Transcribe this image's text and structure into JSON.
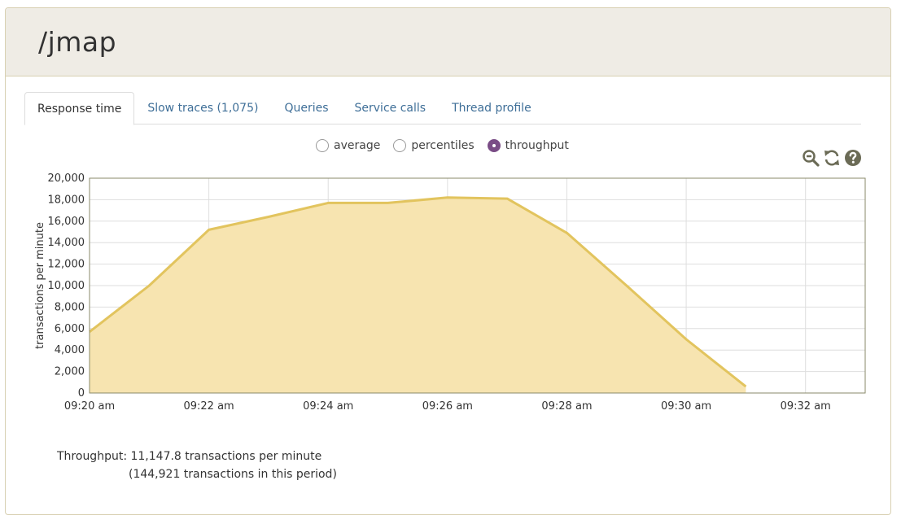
{
  "page": {
    "title": "/jmap"
  },
  "tabs": [
    {
      "label": "Response time",
      "active": true
    },
    {
      "label": "Slow traces (1,075)",
      "active": false
    },
    {
      "label": "Queries",
      "active": false
    },
    {
      "label": "Service calls",
      "active": false
    },
    {
      "label": "Thread profile",
      "active": false
    }
  ],
  "view_options": {
    "average": "average",
    "percentiles": "percentiles",
    "throughput": "throughput",
    "selected": "throughput"
  },
  "tools": [
    "zoom-out-icon",
    "refresh-icon",
    "help-icon"
  ],
  "colors": {
    "area_fill": "#f7e4b0",
    "area_line": "#e2c45e",
    "link": "#3f6f98",
    "radio_selected": "#7a4d86",
    "header_bg": "#efece5"
  },
  "chart_data": {
    "type": "area",
    "ylabel": "transactions per minute",
    "xlabel": "",
    "x_ticks": [
      "09:20 am",
      "09:22 am",
      "09:24 am",
      "09:26 am",
      "09:28 am",
      "09:30 am",
      "09:32 am"
    ],
    "x": [
      "09:20 am",
      "09:21 am",
      "09:22 am",
      "09:23 am",
      "09:24 am",
      "09:25 am",
      "09:26 am",
      "09:27 am",
      "09:28 am",
      "09:29 am",
      "09:30 am",
      "09:31 am"
    ],
    "values": [
      5700,
      10000,
      15200,
      16400,
      17700,
      17700,
      18200,
      18100,
      14900,
      10000,
      5000,
      600
    ],
    "x_range": [
      "09:20 am",
      "09:33 am"
    ],
    "ylim": [
      0,
      20000
    ],
    "y_ticks": [
      0,
      2000,
      4000,
      6000,
      8000,
      10000,
      12000,
      14000,
      16000,
      18000,
      20000
    ],
    "grid": true
  },
  "summary": {
    "line1": "Throughput: 11,147.8 transactions per minute",
    "line2": "(144,921 transactions in this period)"
  }
}
